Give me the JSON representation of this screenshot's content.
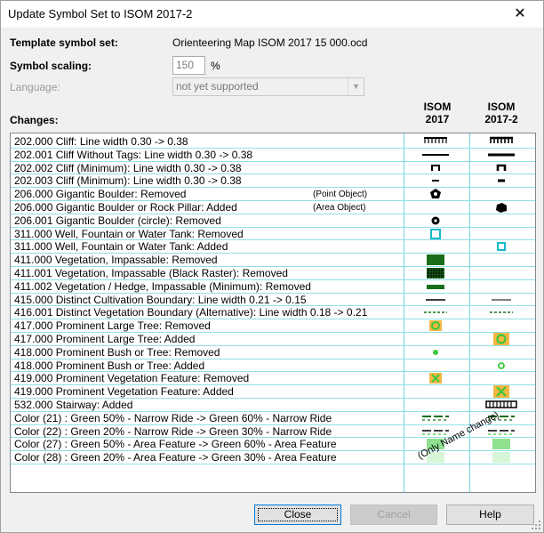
{
  "window": {
    "title": "Update Symbol Set to ISOM 2017-2",
    "close_glyph": "✕"
  },
  "form": {
    "template_label": "Template symbol set:",
    "template_value": "Orienteering Map ISOM 2017 15 000.ocd",
    "scaling_label": "Symbol scaling:",
    "scaling_value": "150",
    "scaling_unit": "%",
    "language_label": "Language:",
    "language_value": "not yet supported",
    "changes_label": "Changes:"
  },
  "columns": {
    "old_line1": "ISOM",
    "old_line2": "2017",
    "new_line1": "ISOM",
    "new_line2": "2017-2"
  },
  "changes": [
    {
      "text": "202.000 Cliff: Line width 0.30 -> 0.38",
      "note": "",
      "old_sym": "cliff-wide-icon",
      "new_sym": "cliff-wide-bold-icon"
    },
    {
      "text": "202.001 Cliff Without Tags: Line width 0.30 -> 0.38",
      "note": "",
      "old_sym": "line-icon",
      "new_sym": "line-bold-icon"
    },
    {
      "text": "202.002 Cliff (Minimum): Line width 0.30 -> 0.38",
      "note": "",
      "old_sym": "cliff-min-icon",
      "new_sym": "cliff-min-bold-icon"
    },
    {
      "text": "202.003 Cliff (Minimum): Line width 0.30 -> 0.38",
      "note": "",
      "old_sym": "short-line-icon",
      "new_sym": "short-line-bold-icon"
    },
    {
      "text": "206.000 Gigantic Boulder: Removed",
      "note": "(Point Object)",
      "old_sym": "pentagon-icon",
      "new_sym": ""
    },
    {
      "text": "206.000 Gigantic Boulder or Rock Pillar: Added",
      "note": "(Area Object)",
      "old_sym": "",
      "new_sym": "blob-icon"
    },
    {
      "text": "206.001 Gigantic Boulder (circle): Removed",
      "note": "",
      "old_sym": "ring-dot-icon",
      "new_sym": ""
    },
    {
      "text": "311.000 Well, Fountain or Water Tank: Removed",
      "note": "",
      "old_sym": "cyan-square-icon",
      "new_sym": ""
    },
    {
      "text": "311.000 Well, Fountain or Water Tank: Added",
      "note": "",
      "old_sym": "",
      "new_sym": "cyan-square-small-icon"
    },
    {
      "text": "411.000 Vegetation, Impassable: Removed",
      "note": "",
      "old_sym": "green-block-icon",
      "new_sym": ""
    },
    {
      "text": "411.001 Vegetation, Impassable (Black Raster): Removed",
      "note": "",
      "old_sym": "green-raster-icon",
      "new_sym": ""
    },
    {
      "text": "411.002 Vegetation / Hedge, Impassable (Minimum): Removed",
      "note": "",
      "old_sym": "green-bar-icon",
      "new_sym": ""
    },
    {
      "text": "415.000 Distinct Cultivation Boundary: Line width 0.21 -> 0.15",
      "note": "",
      "old_sym": "thin-line-icon",
      "new_sym": "thinner-line-icon"
    },
    {
      "text": "416.001 Distinct Vegetation Boundary (Alternative): Line width 0.18 -> 0.21",
      "note": "",
      "old_sym": "green-dash-icon",
      "new_sym": "green-dash-icon"
    },
    {
      "text": "417.000 Prominent Large Tree: Removed",
      "note": "",
      "old_sym": "tree-large-icon",
      "new_sym": ""
    },
    {
      "text": "417.000 Prominent Large Tree: Added",
      "note": "",
      "old_sym": "",
      "new_sym": "tree-large-new-icon"
    },
    {
      "text": "418.000 Prominent Bush or Tree: Removed",
      "note": "",
      "old_sym": "green-dot-icon",
      "new_sym": ""
    },
    {
      "text": "418.000 Prominent Bush or Tree: Added",
      "note": "",
      "old_sym": "",
      "new_sym": "green-ring-icon"
    },
    {
      "text": "419.000 Prominent Vegetation Feature: Removed",
      "note": "",
      "old_sym": "green-x-icon",
      "new_sym": ""
    },
    {
      "text": "419.000 Prominent Vegetation Feature: Added",
      "note": "",
      "old_sym": "",
      "new_sym": "green-x-new-icon"
    },
    {
      "text": "532.000 Stairway: Added",
      "note": "",
      "old_sym": "",
      "new_sym": "stairway-icon"
    },
    {
      "text": "Color (21) : Green 50% - Narrow Ride -> Green 60% - Narrow Ride",
      "note": "",
      "old_sym": "ride-dash-icon",
      "new_sym": "ride-dash-icon"
    },
    {
      "text": "Color (22) : Green 20% - Narrow Ride -> Green 30% - Narrow Ride",
      "note": "",
      "old_sym": "ride-dash-black-icon",
      "new_sym": "ride-dash-black-icon"
    },
    {
      "text": "Color (27) : Green 50% - Area Feature -> Green 60% - Area Feature",
      "note": "",
      "old_sym": "area-green-icon",
      "new_sym": "area-green-icon"
    },
    {
      "text": "Color (28) : Green 20% - Area Feature -> Green 30% - Area Feature",
      "note": "",
      "old_sym": "area-lightgreen-icon",
      "new_sym": "area-lightgreen-icon"
    }
  ],
  "only_name_note": "(Only Name change)",
  "buttons": {
    "close": "Close",
    "cancel": "Cancel",
    "help": "Help"
  },
  "colors": {
    "grid": "#6fd8e0",
    "cyan_symbol": "#1ab8c8",
    "green_dark": "#1a6e1a",
    "green_bright": "#3cc83c",
    "orange": "#f5b642"
  }
}
